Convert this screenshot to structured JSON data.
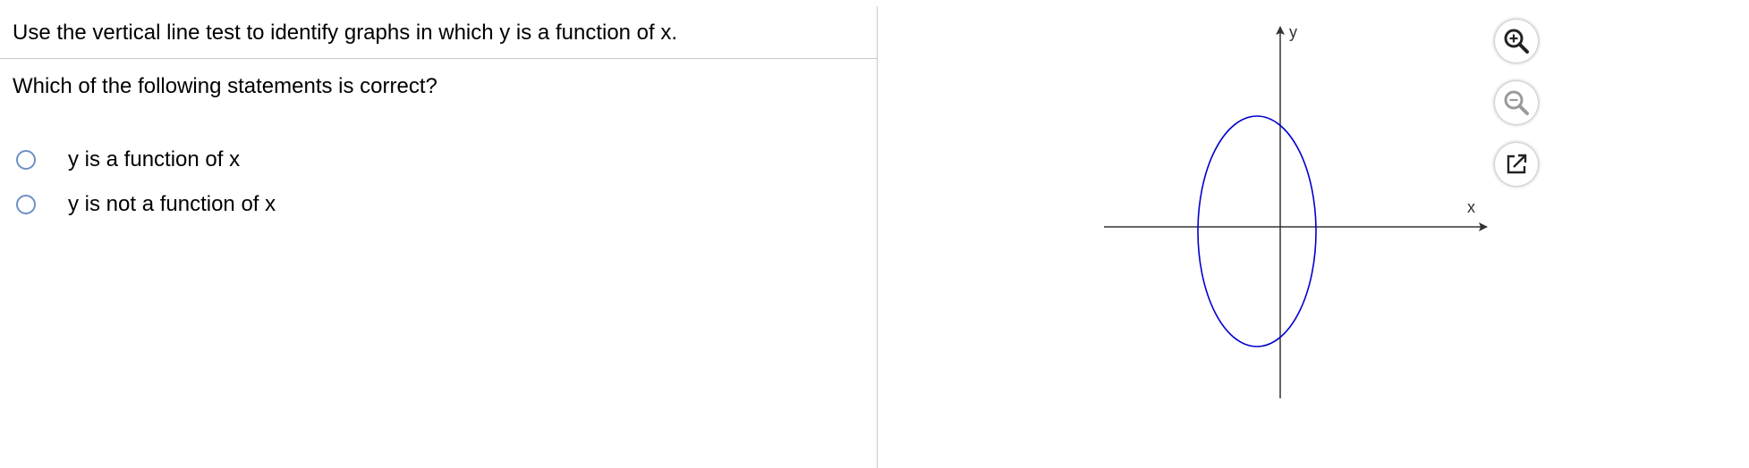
{
  "question": {
    "instruction": "Use the vertical line test to identify graphs in which y is a function of x.",
    "prompt": "Which of the following statements is correct?",
    "options": [
      {
        "label": "y is a function of x",
        "selected": false
      },
      {
        "label": "y is not a function of x",
        "selected": false
      }
    ]
  },
  "graph": {
    "x_axis_label": "x",
    "y_axis_label": "y",
    "curve": "ellipse",
    "curve_color": "#0000cc",
    "axis_color": "#333333"
  },
  "tools": [
    {
      "name": "zoom-in-icon"
    },
    {
      "name": "zoom-out-icon"
    },
    {
      "name": "popout-icon"
    }
  ]
}
